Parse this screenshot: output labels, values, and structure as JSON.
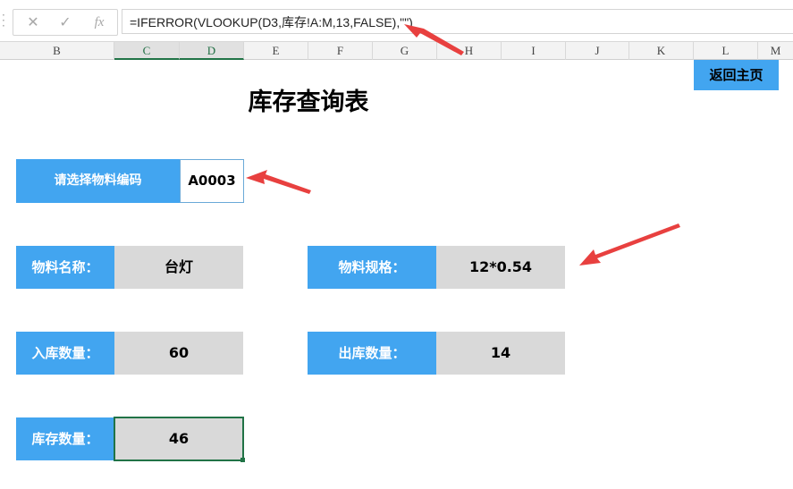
{
  "formula_bar": {
    "cancel_icon": "✕",
    "enter_icon": "✓",
    "fx_label": "fx",
    "formula": "=IFERROR(VLOOKUP(D3,库存!A:M,13,FALSE),\"\")"
  },
  "columns": [
    "B",
    "C",
    "D",
    "E",
    "F",
    "G",
    "H",
    "I",
    "J",
    "K",
    "L",
    "M"
  ],
  "selected_columns": [
    "C",
    "D"
  ],
  "sheet": {
    "title": "库存查询表",
    "home_button": "返回主页",
    "select_label": "请选择物料编码",
    "select_value": "A0003",
    "name_label": "物料名称：",
    "name_value": "台灯",
    "spec_label": "物料规格：",
    "spec_value": "12*0.54",
    "in_label": "入库数量：",
    "in_value": "60",
    "out_label": "出库数量：",
    "out_value": "14",
    "stock_label": "库存数量：",
    "stock_value": "46"
  },
  "colors": {
    "label_blue": "#42a5f0",
    "value_gray": "#d9d9d9",
    "selection_green": "#217346",
    "arrow_red": "#e8403f"
  }
}
